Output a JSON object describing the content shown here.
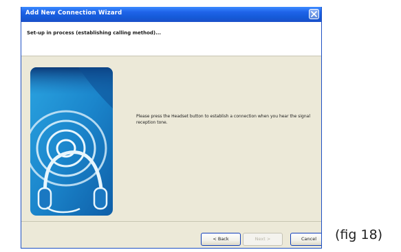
{
  "window": {
    "title": "Add New Connection Wizard"
  },
  "header": {
    "status_text": "Set-up in process (establishing calling method)..."
  },
  "body": {
    "instruction_text": "Please press the Headset button to establish a connection when you hear the signal reception tone."
  },
  "buttons": {
    "back_label": "< Back",
    "next_label": "Next >",
    "cancel_label": "Cancel"
  },
  "caption": "(fig 18)",
  "icons": [
    "close-icon",
    "headset-signal-icon"
  ],
  "colors": {
    "titlebar": "#1e63e8",
    "dialog_bg": "#ece9d8",
    "illustration_bg": "#1f8fd0"
  }
}
